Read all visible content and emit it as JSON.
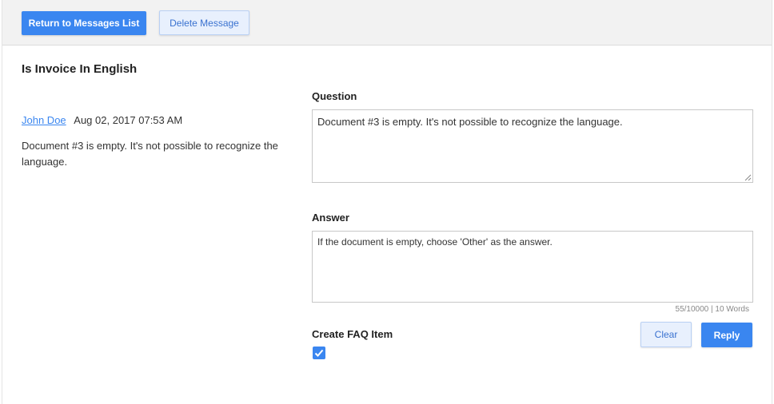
{
  "toolbar": {
    "return_label": "Return to Messages List",
    "delete_label": "Delete Message"
  },
  "message": {
    "title": "Is Invoice In English",
    "author": "John Doe",
    "timestamp": "Aug 02, 2017 07:53 AM",
    "body": "Document #3 is empty. It's not possible to recognize the language."
  },
  "form": {
    "question_label": "Question",
    "question_value": "Document #3 is empty. It's not possible to recognize the language.",
    "answer_label": "Answer",
    "answer_value": "If the document is empty, choose 'Other' as the answer.",
    "counter": "55/10000 | 10 Words",
    "faq_label": "Create FAQ Item",
    "faq_checked": true,
    "clear_label": "Clear",
    "reply_label": "Reply"
  },
  "icons": {
    "checkbox": "check-icon",
    "resize": "resize-grip-icon"
  },
  "colors": {
    "accent": "#3a86f0",
    "secondary_bg": "#e8f0fd",
    "toolbar_bg": "#f2f2f2"
  }
}
